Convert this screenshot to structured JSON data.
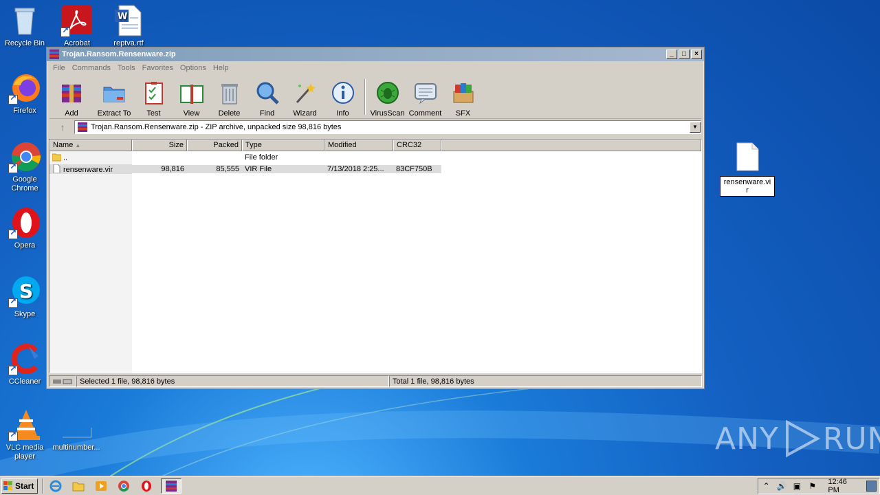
{
  "desktop": {
    "icons": [
      {
        "label": "Recycle Bin"
      },
      {
        "label": "Acrobat"
      },
      {
        "label": "reptva.rtf"
      },
      {
        "label": "Firefox"
      },
      {
        "label": "Google Chrome"
      },
      {
        "label": "Opera"
      },
      {
        "label": "Skype"
      },
      {
        "label": "CCleaner"
      },
      {
        "label": "VLC media player"
      },
      {
        "label": "multinumber..."
      }
    ],
    "floating_file": {
      "label": "rensenware.vi\nr"
    },
    "watermark": {
      "text_left": "ANY",
      "text_right": "RUN"
    }
  },
  "window": {
    "title": "Trojan.Ransom.Rensenware.zip",
    "menu": [
      "File",
      "Commands",
      "Tools",
      "Favorites",
      "Options",
      "Help"
    ],
    "toolbar": [
      {
        "label": "Add",
        "icon": "add-icon"
      },
      {
        "label": "Extract To",
        "icon": "extract-icon"
      },
      {
        "label": "Test",
        "icon": "test-icon"
      },
      {
        "label": "View",
        "icon": "view-icon"
      },
      {
        "label": "Delete",
        "icon": "delete-icon"
      },
      {
        "label": "Find",
        "icon": "find-icon"
      },
      {
        "label": "Wizard",
        "icon": "wizard-icon"
      },
      {
        "label": "Info",
        "icon": "info-icon"
      },
      {
        "label": "VirusScan",
        "icon": "virusscan-icon"
      },
      {
        "label": "Comment",
        "icon": "comment-icon"
      },
      {
        "label": "SFX",
        "icon": "sfx-icon"
      }
    ],
    "address": "Trojan.Ransom.Rensenware.zip - ZIP archive, unpacked size 98,816 bytes",
    "columns": {
      "name": "Name",
      "size": "Size",
      "packed": "Packed",
      "type": "Type",
      "modified": "Modified",
      "crc": "CRC32"
    },
    "rows": [
      {
        "name": "..",
        "size": "",
        "packed": "",
        "type": "File folder",
        "modified": "",
        "crc": ""
      },
      {
        "name": "rensenware.vir",
        "size": "98,816",
        "packed": "85,555",
        "type": "VIR File",
        "modified": "7/13/2018 2:25...",
        "crc": "83CF750B"
      }
    ],
    "status_left": "Selected 1 file, 98,816 bytes",
    "status_right": "Total 1 file, 98,816 bytes"
  },
  "taskbar": {
    "start_label": "Start",
    "clock": "12:46 PM"
  }
}
